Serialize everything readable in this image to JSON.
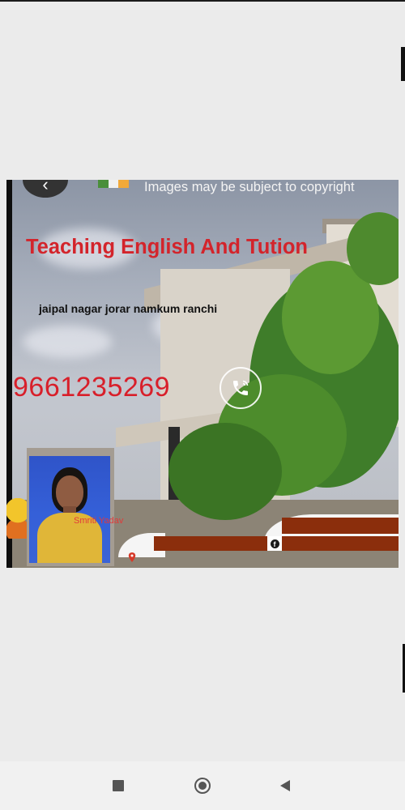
{
  "viewer": {
    "copyright_notice": "Images may be subject to copyright",
    "back_icon": "chevron-left-icon"
  },
  "poster": {
    "title": "Teaching English And Tution",
    "address": "jaipal nagar jorar namkum ranchi",
    "phone": "9661235269",
    "person_name": "Smriti Yadav",
    "call_icon": "phone-icon",
    "social_icon": "facebook-icon",
    "location_icon": "location-pin-icon",
    "colors": {
      "title": "#d3242b",
      "phone": "#d81f2a",
      "banner": "#8b2e0c"
    }
  },
  "navbar": {
    "recents_icon": "square-icon",
    "home_icon": "circle-icon",
    "back_icon": "triangle-back-icon"
  }
}
